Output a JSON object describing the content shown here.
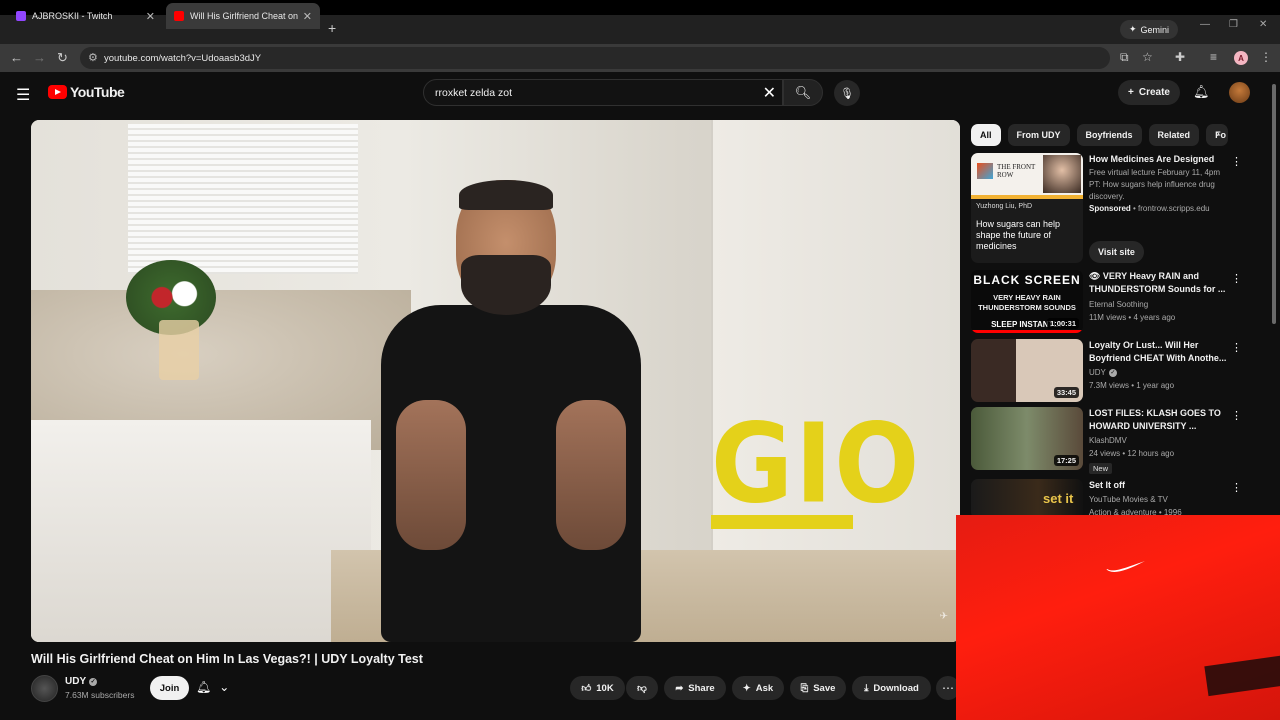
{
  "browser": {
    "tabs": [
      {
        "label": "AJBROSKII - Twitch",
        "active": false,
        "favicon_color": "#9146ff"
      },
      {
        "label": "Will His Girlfriend Cheat on Him",
        "active": true,
        "favicon_color": "#ff0000"
      }
    ],
    "new_tab": "+",
    "gemini_label": "Gemini",
    "url": "youtube.com/watch?v=Udoaasb3dJY",
    "profile_initial": "A"
  },
  "youtube": {
    "logo_text": "YouTube",
    "search_value": "rroxket zelda zot",
    "create_label": "Create"
  },
  "video": {
    "overlay_text": "GIO",
    "title": "Will His Girlfriend Cheat on Him In Las Vegas?! | UDY Loyalty Test",
    "channel": "UDY",
    "subscribers": "7.63M subscribers",
    "join_label": "Join",
    "likes": "10K",
    "share_label": "Share",
    "ask_label": "Ask",
    "save_label": "Save",
    "download_label": "Download"
  },
  "sidebar": {
    "chips": [
      "All",
      "From UDY",
      "Boyfriends",
      "Related",
      "Fo"
    ],
    "recommendations": [
      {
        "title": "How Medicines Are Designed",
        "meta1": "Free virtual lecture February 11, 4pm PT: How sugars help influence drug discovery.",
        "sponsored": "Sponsored",
        "sponsor_site": "frontrow.scripps.edu",
        "visit_label": "Visit site",
        "thumb_brand": "THE FRONT ROW",
        "thumb_name": "Yuzhong Liu, PhD",
        "thumb_caption": "How sugars can help shape the future of medicines"
      },
      {
        "title": "👁 VERY Heavy RAIN and THUNDERSTORM Sounds for ...",
        "channel": "Eternal Soothing",
        "stats": "11M views • 4 years ago",
        "duration": "1:00:31",
        "thumb_line1": "BLACK SCREEN",
        "thumb_line2": "VERY HEAVY RAIN THUNDERSTORM SOUNDS",
        "thumb_line3": "SLEEP INSTANTLY"
      },
      {
        "title": "Loyalty Or Lust... Will Her Boyfriend CHEAT With Anothe...",
        "channel": "UDY",
        "stats": "7.3M views • 1 year ago",
        "duration": "33:45"
      },
      {
        "title": "LOST FILES: KLASH GOES TO HOWARD UNIVERSITY ...",
        "channel": "KlashDMV",
        "stats": "24 views • 12 hours ago",
        "duration": "17:25",
        "badge": "New"
      },
      {
        "title": "Set It off",
        "channel": "YouTube Movies & TV",
        "stats": "Action & adventure • 1996",
        "thumb_text": "set it"
      }
    ]
  },
  "colors": {
    "accent_red": "#ff0000",
    "gio_yellow": "#e4d11a",
    "overlay_red": "#ff1e0e"
  }
}
